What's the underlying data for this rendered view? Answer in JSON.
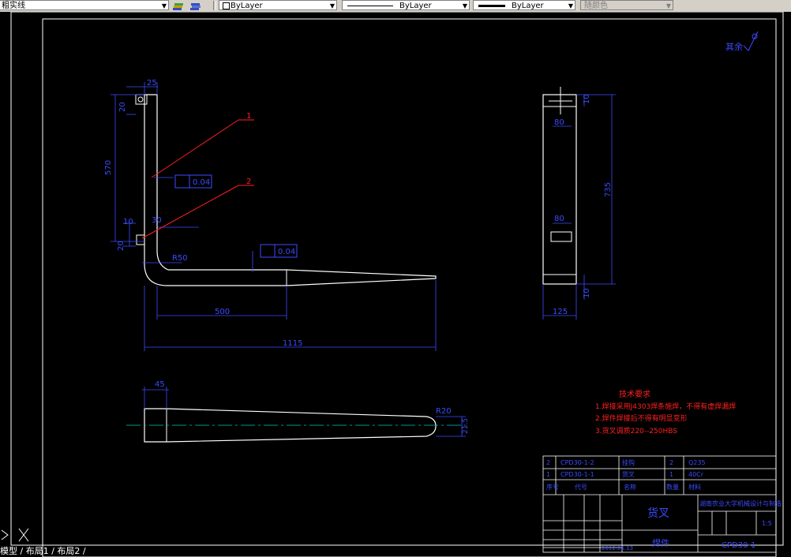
{
  "toolbar": {
    "linetype_name": "粗实线",
    "layer_color": "ByLayer",
    "linetype": "ByLayer",
    "lineweight": "ByLayer",
    "plot_style": "随颜色"
  },
  "tabs": {
    "model": "模型",
    "layout1": "布局1",
    "layout2": "布局2"
  },
  "drawing": {
    "surface_finish": "其余",
    "leaders": [
      "1",
      "2"
    ],
    "tolerance_1": "0.04",
    "tolerance_2": "0.04",
    "front_view": {
      "dim_25": "25",
      "dim_20_top": "20",
      "dim_570": "570",
      "dim_10": "10",
      "dim_30": "30",
      "dim_20_bottom": "20",
      "dim_r50": "R50",
      "dim_500": "500",
      "dim_1115": "1115"
    },
    "side_view": {
      "dim_80_top": "80",
      "dim_80_mid": "80",
      "dim_10_top": "10",
      "dim_735": "735",
      "dim_10_bottom": "10",
      "dim_125": "125"
    },
    "top_view": {
      "dim_45": "45",
      "dim_r20": "R20",
      "dim_right": "21.5"
    },
    "requirements": {
      "title": "技术要求",
      "line1": "1.焊接采用J4303焊条施焊，不得有虚焊漏焊",
      "line2": "2.焊件焊接后不得有明显变形",
      "line3": "3.货叉调质220--250HBS"
    },
    "title_block": {
      "part_name": "货叉",
      "material": "焊件",
      "school": "湖南农业大学机械设计与制造",
      "scale": "1:5",
      "drawing_no": "CPD30-1",
      "date": "2012.05.13",
      "bom_row1_no": "2",
      "bom_row2_no": "1",
      "bom_row1_code": "CPD30-1-2",
      "bom_row2_code": "CPD30-1-1",
      "bom_row1_name": "挂钩",
      "bom_row2_name": "货叉",
      "bom_qty1": "2",
      "bom_qty2": "1",
      "bom_mat1": "Q235",
      "bom_mat2": "40Cr",
      "hdr_no": "序号",
      "hdr_code": "代号",
      "hdr_name": "名称",
      "hdr_qty": "数量",
      "hdr_mat": "材料"
    }
  }
}
